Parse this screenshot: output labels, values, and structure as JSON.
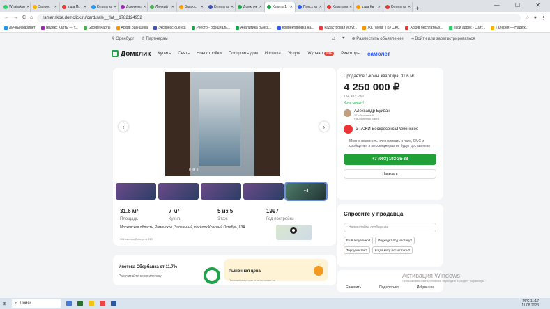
{
  "browser": {
    "tabs": [
      "WhatsApp",
      "Запрос",
      "узда Пк",
      "Купить кв",
      "Документ",
      "Личный",
      "Запрос",
      "Купить кв",
      "Домклик",
      "Купить 1",
      "Поиск кв",
      "Купить кв",
      "узда Кв",
      "Купить кв"
    ],
    "url": "ramenskoe.domclick.ru/card/sale__flat__1782124952",
    "window_controls": "— ☐ ✕"
  },
  "bookmarks": [
    "Личный кабинет",
    "Яндекс Карты — т...",
    "Google Карты",
    "Архив оценщика",
    "Экспресс-оценка",
    "Реестр - официаль...",
    "Аналитика рынка...",
    "Корректировка на...",
    "Кадастровая услуг...",
    "ЖК \"Мега\" | БУСЖС",
    "Архив бесплатных...",
    "Твой адрес - Сайт...",
    "Галерея — Надеж..."
  ],
  "topbar": {
    "city": "Оренбург",
    "partners": "Партнерам",
    "post": "Разместить объявление",
    "login": "Войти или зарегистрироваться"
  },
  "nav": {
    "logo": "Домклик",
    "items": [
      "Купить",
      "Снять",
      "Новостройки",
      "Построить дом",
      "Ипотека",
      "Услуги",
      "Журнал",
      "Риелторы"
    ],
    "badge": "99+",
    "samolet": "самолет"
  },
  "gallery": {
    "counter": "8 из 9",
    "more": "+4"
  },
  "stats": [
    {
      "value": "31.6 м²",
      "label": "Площадь"
    },
    {
      "value": "7 м²",
      "label": "Кухня"
    },
    {
      "value": "5 из 5",
      "label": "Этаж"
    },
    {
      "value": "1997",
      "label": "Год постройки"
    }
  ],
  "address": "Московская область, Раменское, Заленьный, посёлок Красный Октябрь, 63А",
  "updated": "Обновлено 2 августа   219",
  "promo": {
    "a_title": "Ипотека Сбербанка от 11.7%",
    "a_sub": "Рассчитайте свою ипотеку",
    "b_title": "Рыночная цена",
    "b_sub": "Похожие квартиры стоят столько же"
  },
  "sidebar": {
    "title": "Продается 1-комн. квартира, 31.6 м²",
    "price": "4 250 000 ₽",
    "ppm": "134 493 ₽/м²",
    "discount": "Хочу скидку!",
    "agent_name": "Александр Буйван",
    "agent_ads": "27 объявлений",
    "agent_since": "На Домклике 5 мес.",
    "agency": "ЭТАЖИ Воскресенск/Раменское",
    "note": "Можно позвонить или написать в чате, СМС и сообщения в мессенджерах не будут доставлены",
    "phone": "+7 (903) 192-35-38",
    "write": "Написать"
  },
  "ask": {
    "title": "Спросите у продавца",
    "placeholder": "Напечатайте сообщение",
    "chips": [
      "Ещё актуально?",
      "Подходит под ипотеку?",
      "Торг уместен?",
      "Когда могу посмотреть?"
    ]
  },
  "actions": {
    "compare": "Сравнить",
    "share": "Поделиться",
    "fav": "Избранное"
  },
  "watermark": {
    "title": "Активация Windows",
    "sub": "Чтобы активировать Windows, перейдите в раздел \"Параметры\"."
  },
  "taskbar": {
    "search": "Поиск",
    "lang": "РУС",
    "time": "11:17",
    "date": "11.08.2023"
  },
  "colors": {
    "green": "#21a038",
    "accent": "#2d5bff",
    "bg": "#f3f4f6"
  }
}
